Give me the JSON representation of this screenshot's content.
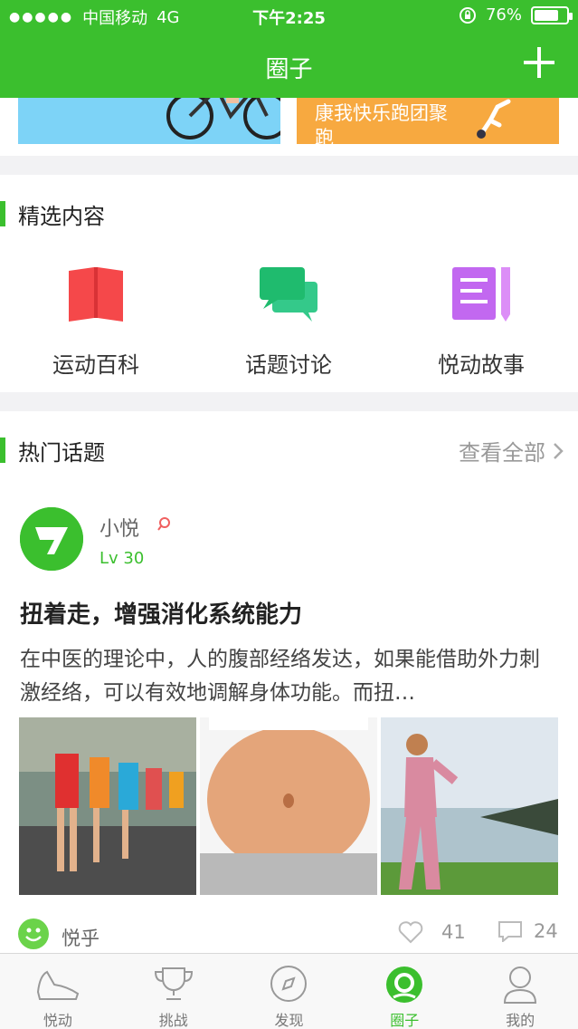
{
  "status_bar": {
    "carrier": "中国移动",
    "network": "4G",
    "time": "下午2:25",
    "battery_text": "76%",
    "battery_level": 0.76
  },
  "header": {
    "title": "圈子",
    "add_icon": "plus-icon"
  },
  "banners": [
    {
      "icon": "bicycle-image",
      "text": ""
    },
    {
      "icon": "runner-image",
      "text": "康我快乐跑团聚\n跑"
    }
  ],
  "featured": {
    "title": "精选内容",
    "items": [
      {
        "label": "运动百科",
        "icon": "book-icon",
        "color": "#f5484a"
      },
      {
        "label": "话题讨论",
        "icon": "chat-bubbles-icon",
        "color": "#22c275"
      },
      {
        "label": "悦动故事",
        "icon": "document-pen-icon",
        "color": "#c268f0"
      }
    ]
  },
  "hot_topics": {
    "title": "热门话题",
    "see_all": "查看全部",
    "post": {
      "username": "小悦",
      "level": "Lv 30",
      "title": "扭着走，增强消化系统能力",
      "body": "在中医的理论中，人的腹部经络发达，如果能借助外力刺激经络，可以有效地调解身体功能。而扭…",
      "images": [
        "race-walkers-photo",
        "abdomen-photo",
        "woman-walking-photo"
      ],
      "source": "悦乎",
      "likes": "41",
      "comments": "24"
    }
  },
  "tabbar": {
    "items": [
      {
        "label": "悦动",
        "icon": "shoe-icon",
        "active": false
      },
      {
        "label": "挑战",
        "icon": "trophy-icon",
        "active": false
      },
      {
        "label": "发现",
        "icon": "compass-icon",
        "active": false
      },
      {
        "label": "圈子",
        "icon": "circle-icon",
        "active": true
      },
      {
        "label": "我的",
        "icon": "person-icon",
        "active": false
      }
    ]
  },
  "colors": {
    "brand_green": "#3bbf2e",
    "background": "#f2f2f4"
  }
}
